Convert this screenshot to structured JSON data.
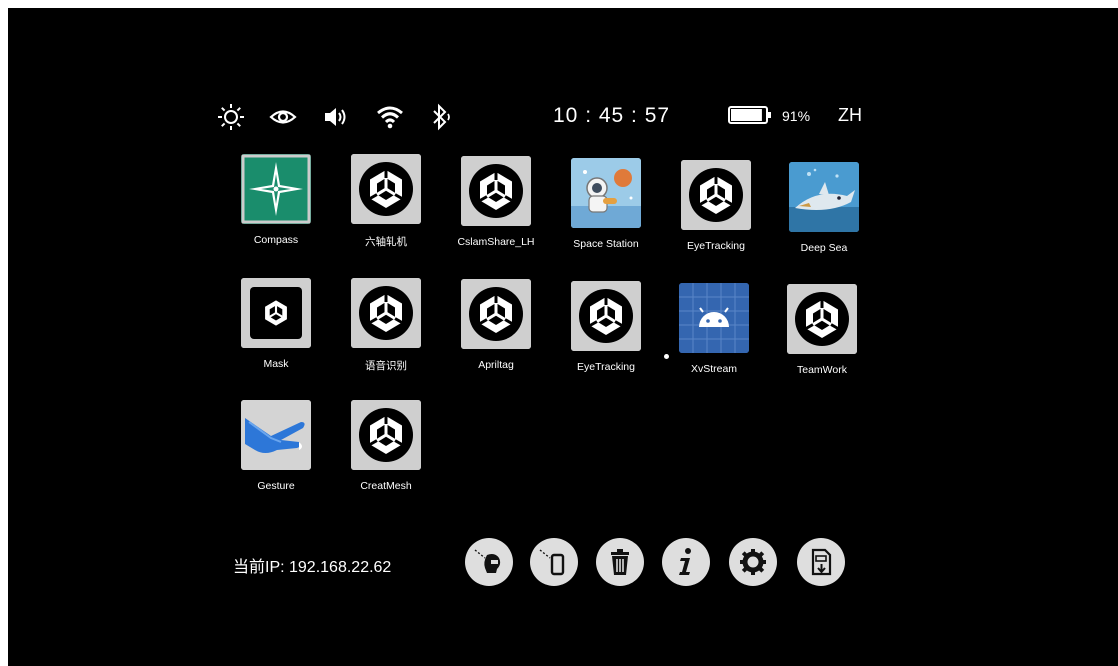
{
  "status_bar": {
    "icons": [
      "brightness-icon",
      "eye-icon",
      "volume-icon",
      "wifi-icon",
      "bluetooth-icon"
    ],
    "time": "10 : 45 : 57",
    "battery_percent": "91%",
    "battery_level": 0.91,
    "language": "ZH"
  },
  "apps": [
    {
      "label": "Compass",
      "icon": "compass-icon"
    },
    {
      "label": "六轴轧机",
      "icon": "unity-icon"
    },
    {
      "label": "CslamShare_LH",
      "icon": "unity-icon"
    },
    {
      "label": "Space Station",
      "icon": "astronaut-icon"
    },
    {
      "label": "EyeTracking",
      "icon": "unity-icon"
    },
    {
      "label": "Deep Sea",
      "icon": "shark-icon"
    },
    {
      "label": "Mask",
      "icon": "unity-icon"
    },
    {
      "label": "语音识别",
      "icon": "unity-icon"
    },
    {
      "label": "Apriltag",
      "icon": "unity-icon"
    },
    {
      "label": "EyeTracking",
      "icon": "unity-icon"
    },
    {
      "label": "XvStream",
      "icon": "android-icon"
    },
    {
      "label": "TeamWork",
      "icon": "unity-icon"
    },
    {
      "label": "Gesture",
      "icon": "hand-icon"
    },
    {
      "label": "CreatMesh",
      "icon": "unity-icon"
    }
  ],
  "footer": {
    "ip_text": "当前IP:  192.168.22.62",
    "actions": [
      "headset-connect-icon",
      "phone-connect-icon",
      "trash-icon",
      "info-icon",
      "settings-icon",
      "file-install-icon"
    ]
  }
}
